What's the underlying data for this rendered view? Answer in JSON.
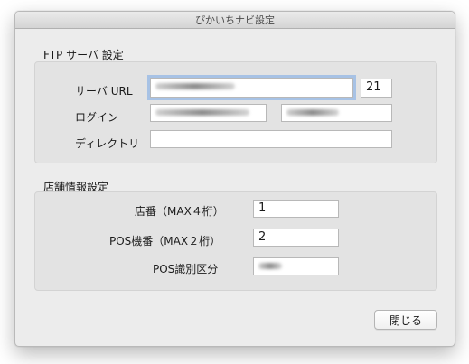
{
  "window": {
    "title": "ぴかいちナビ設定"
  },
  "ftp": {
    "section_title": "FTP サーバ 設定",
    "server_url_label": "サーバ URL",
    "port_value": "21",
    "login_label": "ログイン",
    "directory_label": "ディレクトリ",
    "directory_value": ""
  },
  "store": {
    "section_title": "店舗情報設定",
    "store_no_label": "店番（MAX４桁）",
    "store_no_value": "1",
    "pos_no_label": "POS機番（MAX２桁）",
    "pos_no_value": "2",
    "pos_id_label": "POS識別区分"
  },
  "buttons": {
    "close_label": "閉じる"
  }
}
